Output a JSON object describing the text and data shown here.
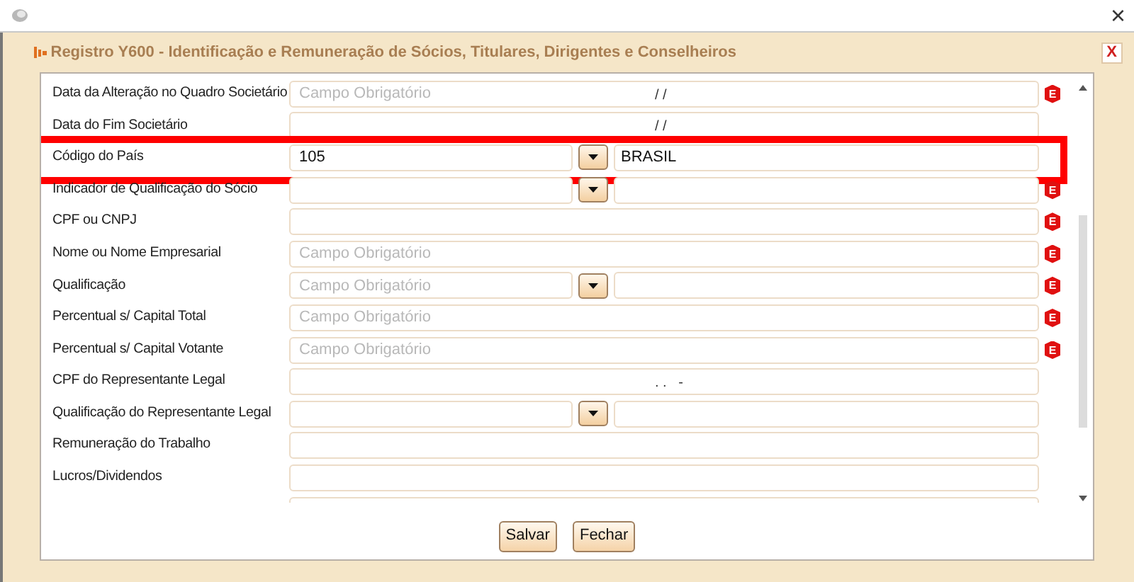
{
  "window": {
    "close_glyph": "×"
  },
  "dialog": {
    "title": "Registro Y600 - Identificação e Remuneração de Sócios, Titulares, Dirigentes e Conselheiros",
    "close_glyph": "X"
  },
  "rows": [
    {
      "kind": "text",
      "label": "Data da Alteração no Quadro Societário",
      "placeholder": "Campo Obrigatório",
      "mask": "/ /",
      "error_mark": "E",
      "highlighted": false
    },
    {
      "kind": "text",
      "label": "Data do Fim Societário",
      "mask": "/ /",
      "highlighted": false
    },
    {
      "kind": "lookup",
      "label": "Código do País",
      "value": "105",
      "description": "BRASIL",
      "highlighted": true
    },
    {
      "kind": "lookup",
      "label": "Indicador de Qualificação do Sócio",
      "error_mark": "E",
      "highlighted": false
    },
    {
      "kind": "text",
      "label": "CPF ou CNPJ",
      "error_mark": "E",
      "highlighted": false
    },
    {
      "kind": "text",
      "label": "Nome ou Nome Empresarial",
      "placeholder": "Campo Obrigatório",
      "error_mark": "E",
      "highlighted": false
    },
    {
      "kind": "lookup",
      "label": "Qualificação",
      "placeholder": "Campo Obrigatório",
      "error_mark": "E",
      "highlighted": false
    },
    {
      "kind": "text",
      "label": "Percentual s/ Capital Total",
      "placeholder": "Campo Obrigatório",
      "error_mark": "E",
      "highlighted": false
    },
    {
      "kind": "text",
      "label": "Percentual s/ Capital Votante",
      "placeholder": "Campo Obrigatório",
      "error_mark": "E",
      "highlighted": false
    },
    {
      "kind": "text",
      "label": "CPF do Representante Legal",
      "mask": ". .   -",
      "highlighted": false
    },
    {
      "kind": "lookup",
      "label": "Qualificação do Representante Legal",
      "highlighted": false
    },
    {
      "kind": "text",
      "label": "Remuneração do Trabalho",
      "highlighted": false
    },
    {
      "kind": "text",
      "label": "Lucros/Dividendos",
      "highlighted": false
    },
    {
      "kind": "text",
      "highlighted": false
    }
  ],
  "buttons": [
    "Salvar",
    "Fechar"
  ]
}
